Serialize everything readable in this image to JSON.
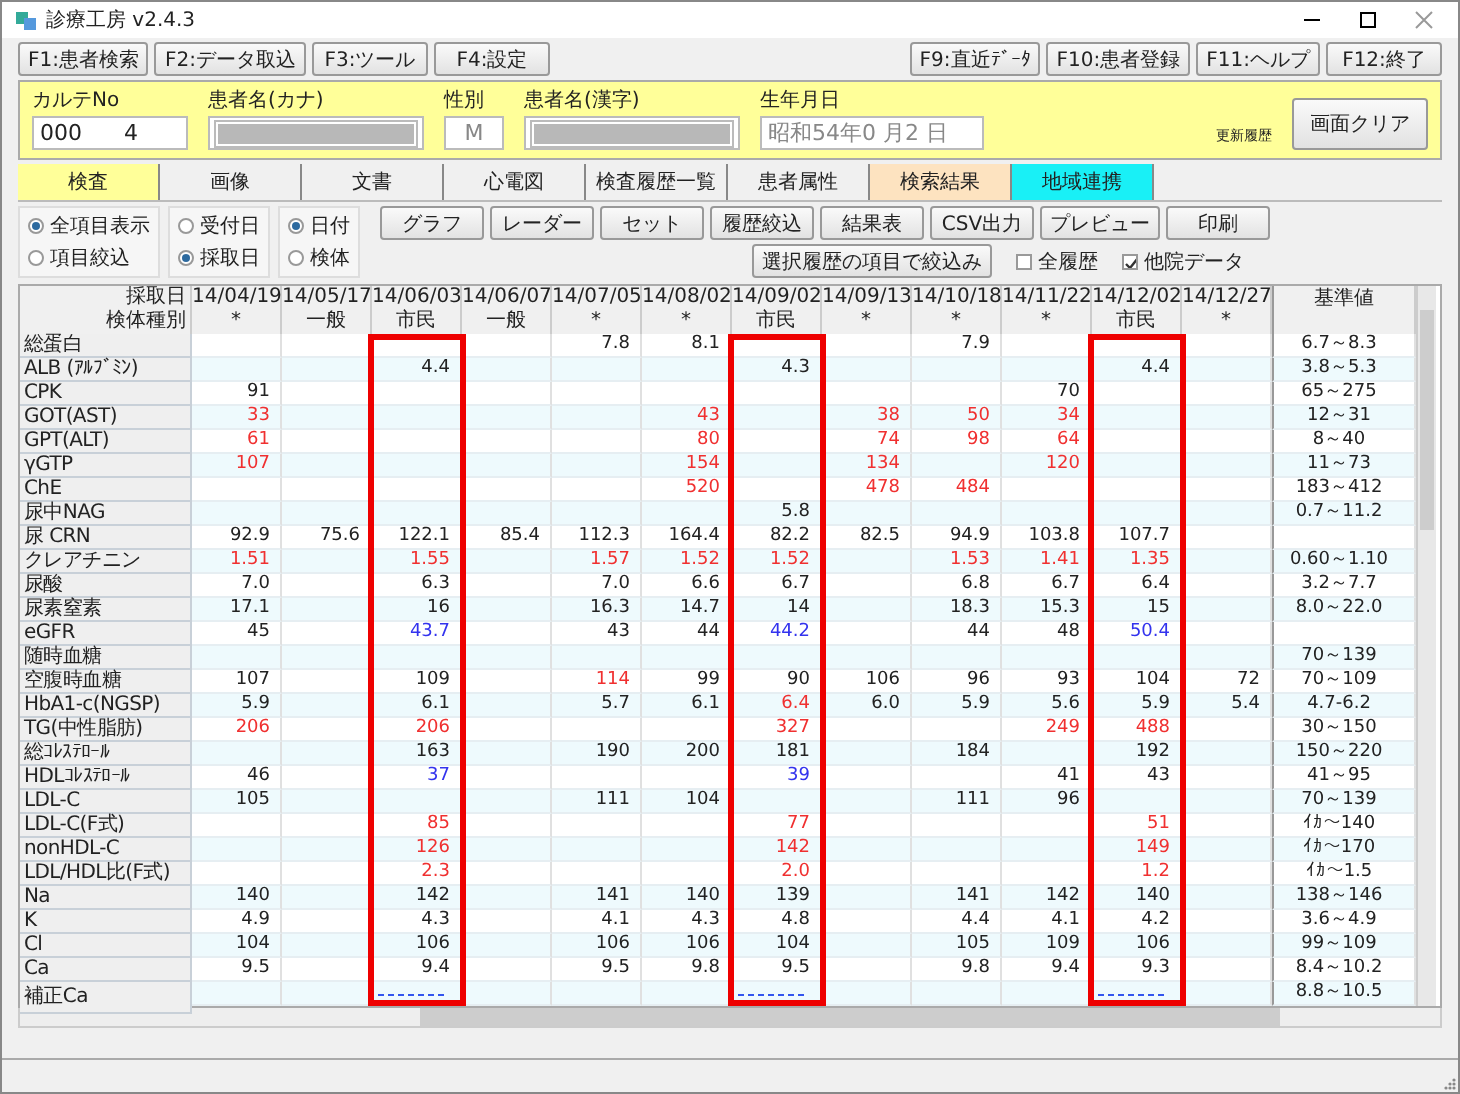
{
  "window": {
    "title": "診療工房 v2.4.3"
  },
  "toolbar": {
    "left": [
      "F1:患者検索",
      "F2:データ取込",
      "F3:ツール",
      "F4:設定"
    ],
    "right": [
      "F9:直近ﾃﾞｰﾀ",
      "F10:患者登録",
      "F11:ヘルプ",
      "F12:終了"
    ]
  },
  "patient": {
    "chart_no_label": "カルテNo",
    "chart_no": "000      4",
    "kana_label": "患者名(カナ)",
    "sex_label": "性別",
    "sex": "M",
    "kanji_label": "患者名(漢字)",
    "birth_label": "生年月日",
    "birth": "昭和54年0 月2 日",
    "history_label": "更新履歴",
    "clear_button": "画面クリア"
  },
  "tabs": [
    {
      "label": "検査",
      "selected": true
    },
    {
      "label": "画像",
      "selected": false
    },
    {
      "label": "文書",
      "selected": false
    },
    {
      "label": "心電図",
      "selected": false
    },
    {
      "label": "検査履歴一覧",
      "selected": false
    },
    {
      "label": "患者属性",
      "selected": false
    },
    {
      "label": "検索結果",
      "selected": false,
      "color": "#fde3c0"
    },
    {
      "label": "地域連携",
      "selected": false,
      "color": "#19f0f6"
    }
  ],
  "radio_groups": [
    [
      {
        "label": "全項目表示",
        "selected": true
      },
      {
        "label": "項目絞込",
        "selected": false
      }
    ],
    [
      {
        "label": "受付日",
        "selected": false
      },
      {
        "label": "採取日",
        "selected": true
      }
    ],
    [
      {
        "label": "日付",
        "selected": true
      },
      {
        "label": "検体",
        "selected": false
      }
    ]
  ],
  "buttons": [
    "グラフ",
    "レーダー",
    "セット",
    "履歴絞込",
    "結果表",
    "CSV出力",
    "プレビュー",
    "印刷"
  ],
  "filter_button": "選択履歴の項目で絞込み",
  "checkboxes": [
    {
      "label": "全履歴",
      "checked": false
    },
    {
      "label": "他院データ",
      "checked": true
    }
  ],
  "table": {
    "date_label": "採取日",
    "type_label": "検体種別",
    "reference_label": "基準値",
    "columns": [
      {
        "date": "14/04/19",
        "type": "*",
        "highlighted": false
      },
      {
        "date": "14/05/17",
        "type": "一般",
        "highlighted": false
      },
      {
        "date": "14/06/03",
        "type": "市民",
        "highlighted": true
      },
      {
        "date": "14/06/07",
        "type": "一般",
        "highlighted": false
      },
      {
        "date": "14/07/05",
        "type": "*",
        "highlighted": false
      },
      {
        "date": "14/08/02",
        "type": "*",
        "highlighted": false
      },
      {
        "date": "14/09/02",
        "type": "市民",
        "highlighted": true
      },
      {
        "date": "14/09/13",
        "type": "*",
        "highlighted": false
      },
      {
        "date": "14/10/18",
        "type": "*",
        "highlighted": false
      },
      {
        "date": "14/11/22",
        "type": "*",
        "highlighted": false
      },
      {
        "date": "14/12/02",
        "type": "市民",
        "highlighted": true
      },
      {
        "date": "14/12/27",
        "type": "*",
        "highlighted": false
      }
    ],
    "rows": [
      {
        "name": "総蛋白",
        "cells": [
          null,
          null,
          null,
          null,
          "7.8",
          "8.1",
          null,
          null,
          "7.9",
          null,
          null,
          null
        ],
        "reference": "6.7～8.3"
      },
      {
        "name": "ALB (ｱﾙﾌﾞﾐﾝ)",
        "cells": [
          null,
          null,
          "4.4",
          null,
          null,
          null,
          "4.3",
          null,
          null,
          null,
          "4.4",
          null
        ],
        "reference": "3.8～5.3"
      },
      {
        "name": "CPK",
        "cells": [
          "91",
          null,
          null,
          null,
          null,
          null,
          null,
          null,
          null,
          "70",
          null,
          null
        ],
        "reference": "65～275"
      },
      {
        "name": "GOT(AST)",
        "cells": [
          {
            "text": "33",
            "color": "#f03030"
          },
          null,
          null,
          null,
          null,
          {
            "text": "43",
            "color": "#f03030"
          },
          null,
          {
            "text": "38",
            "color": "#f03030"
          },
          {
            "text": "50",
            "color": "#f03030"
          },
          {
            "text": "34",
            "color": "#f03030"
          },
          null,
          null
        ],
        "reference": "12～31"
      },
      {
        "name": "GPT(ALT)",
        "cells": [
          {
            "text": "61",
            "color": "#f03030"
          },
          null,
          null,
          null,
          null,
          {
            "text": "80",
            "color": "#f03030"
          },
          null,
          {
            "text": "74",
            "color": "#f03030"
          },
          {
            "text": "98",
            "color": "#f03030"
          },
          {
            "text": "64",
            "color": "#f03030"
          },
          null,
          null
        ],
        "reference": "8～40"
      },
      {
        "name": "γGTP",
        "cells": [
          {
            "text": "107",
            "color": "#f03030"
          },
          null,
          null,
          null,
          null,
          {
            "text": "154",
            "color": "#f03030"
          },
          null,
          {
            "text": "134",
            "color": "#f03030"
          },
          null,
          {
            "text": "120",
            "color": "#f03030"
          },
          null,
          null
        ],
        "reference": "11～73"
      },
      {
        "name": "ChE",
        "cells": [
          null,
          null,
          null,
          null,
          null,
          {
            "text": "520",
            "color": "#f03030"
          },
          null,
          {
            "text": "478",
            "color": "#f03030"
          },
          {
            "text": "484",
            "color": "#f03030"
          },
          null,
          null,
          null
        ],
        "reference": "183～412"
      },
      {
        "name": "尿中NAG",
        "cells": [
          null,
          null,
          null,
          null,
          null,
          null,
          "5.8",
          null,
          null,
          null,
          null,
          null
        ],
        "reference": "0.7～11.2"
      },
      {
        "name": "尿 CRN",
        "cells": [
          "92.9",
          "75.6",
          "122.1",
          "85.4",
          "112.3",
          "164.4",
          "82.2",
          "82.5",
          "94.9",
          "103.8",
          "107.7",
          null
        ]
      },
      {
        "name": "クレアチニン",
        "cells": [
          {
            "text": "1.51",
            "color": "#f03030"
          },
          null,
          {
            "text": "1.55",
            "color": "#f03030"
          },
          null,
          {
            "text": "1.57",
            "color": "#f03030"
          },
          {
            "text": "1.52",
            "color": "#f03030"
          },
          {
            "text": "1.52",
            "color": "#f03030"
          },
          null,
          {
            "text": "1.53",
            "color": "#f03030"
          },
          {
            "text": "1.41",
            "color": "#f03030"
          },
          {
            "text": "1.35",
            "color": "#f03030"
          },
          null
        ],
        "reference": "0.60～1.10"
      },
      {
        "name": "尿酸",
        "cells": [
          "7.0",
          null,
          "6.3",
          null,
          "7.0",
          "6.6",
          "6.7",
          null,
          "6.8",
          "6.7",
          "6.4",
          null
        ],
        "reference": "3.2～7.7"
      },
      {
        "name": "尿素窒素",
        "cells": [
          "17.1",
          null,
          "16",
          null,
          "16.3",
          "14.7",
          "14",
          null,
          "18.3",
          "15.3",
          "15",
          null
        ],
        "reference": "8.0～22.0"
      },
      {
        "name": "eGFR",
        "cells": [
          "45",
          null,
          {
            "text": "43.7",
            "color": "#3333ee"
          },
          null,
          "43",
          "44",
          {
            "text": "44.2",
            "color": "#3333ee"
          },
          null,
          "44",
          "48",
          {
            "text": "50.4",
            "color": "#3333ee"
          },
          null
        ]
      },
      {
        "name": "随時血糖",
        "cells": [
          null,
          null,
          null,
          null,
          null,
          null,
          null,
          null,
          null,
          null,
          null,
          null
        ],
        "reference": "70～139"
      },
      {
        "name": "空腹時血糖",
        "cells": [
          "107",
          null,
          "109",
          null,
          {
            "text": "114",
            "color": "#f03030"
          },
          "99",
          "90",
          "106",
          "96",
          "93",
          "104",
          "72"
        ],
        "reference": "70～109"
      },
      {
        "name": "HbA1-c(NGSP)",
        "cells": [
          "5.9",
          null,
          "6.1",
          null,
          "5.7",
          "6.1",
          {
            "text": "6.4",
            "color": "#f03030"
          },
          "6.0",
          "5.9",
          "5.6",
          "5.9",
          "5.4"
        ],
        "reference": "4.7-6.2"
      },
      {
        "name": "TG(中性脂肪)",
        "cells": [
          {
            "text": "206",
            "color": "#f03030"
          },
          null,
          {
            "text": "206",
            "color": "#f03030"
          },
          null,
          null,
          null,
          {
            "text": "327",
            "color": "#f03030"
          },
          null,
          null,
          {
            "text": "249",
            "color": "#f03030"
          },
          {
            "text": "488",
            "color": "#f03030"
          },
          null
        ],
        "reference": "30～150"
      },
      {
        "name": "総ｺﾚｽﾃﾛｰﾙ",
        "cells": [
          null,
          null,
          "163",
          null,
          "190",
          "200",
          "181",
          null,
          "184",
          null,
          "192",
          null
        ],
        "reference": "150～220"
      },
      {
        "name": "HDLｺﾚｽﾃﾛｰﾙ",
        "cells": [
          "46",
          null,
          {
            "text": "37",
            "color": "#3333ee"
          },
          null,
          null,
          null,
          {
            "text": "39",
            "color": "#3333ee"
          },
          null,
          null,
          "41",
          "43",
          null
        ],
        "reference": "41～95"
      },
      {
        "name": "LDL-C",
        "cells": [
          "105",
          null,
          null,
          null,
          "111",
          "104",
          null,
          null,
          "111",
          "96",
          null,
          null
        ],
        "reference": "70～139"
      },
      {
        "name": "LDL-C(F式)",
        "cells": [
          null,
          null,
          {
            "text": "85",
            "color": "#f03030"
          },
          null,
          null,
          null,
          {
            "text": "77",
            "color": "#f03030"
          },
          null,
          null,
          null,
          {
            "text": "51",
            "color": "#f03030"
          },
          null
        ],
        "reference": "ｲｶ～140"
      },
      {
        "name": "nonHDL-C",
        "cells": [
          null,
          null,
          {
            "text": "126",
            "color": "#f03030"
          },
          null,
          null,
          null,
          {
            "text": "142",
            "color": "#f03030"
          },
          null,
          null,
          null,
          {
            "text": "149",
            "color": "#f03030"
          },
          null
        ],
        "reference": "ｲｶ～170"
      },
      {
        "name": "LDL/HDL比(F式)",
        "cells": [
          null,
          null,
          {
            "text": "2.3",
            "color": "#f03030"
          },
          null,
          null,
          null,
          {
            "text": "2.0",
            "color": "#f03030"
          },
          null,
          null,
          null,
          {
            "text": "1.2",
            "color": "#f03030"
          },
          null
        ],
        "reference": "ｲｶ～1.5"
      },
      {
        "name": "Na",
        "cells": [
          "140",
          null,
          "142",
          null,
          "141",
          "140",
          "139",
          null,
          "141",
          "142",
          "140",
          null
        ],
        "reference": "138～146"
      },
      {
        "name": "K",
        "cells": [
          "4.9",
          null,
          "4.3",
          null,
          "4.1",
          "4.3",
          "4.8",
          null,
          "4.4",
          "4.1",
          "4.2",
          null
        ],
        "reference": "3.6～4.9"
      },
      {
        "name": "Cl",
        "cells": [
          "104",
          null,
          "106",
          null,
          "106",
          "106",
          "104",
          null,
          "105",
          "109",
          "106",
          null
        ],
        "reference": "99～109"
      },
      {
        "name": "Ca",
        "cells": [
          "9.5",
          null,
          "9.4",
          null,
          "9.5",
          "9.8",
          "9.5",
          null,
          "9.8",
          "9.4",
          "9.3",
          null
        ],
        "reference": "8.4～10.2"
      },
      {
        "name": "補正Ca",
        "cells": [
          null,
          null,
          {
            "kind": "dash"
          },
          null,
          null,
          null,
          {
            "kind": "dash"
          },
          null,
          null,
          null,
          {
            "kind": "dash"
          },
          null
        ],
        "reference": "8.8～10.5"
      }
    ]
  }
}
